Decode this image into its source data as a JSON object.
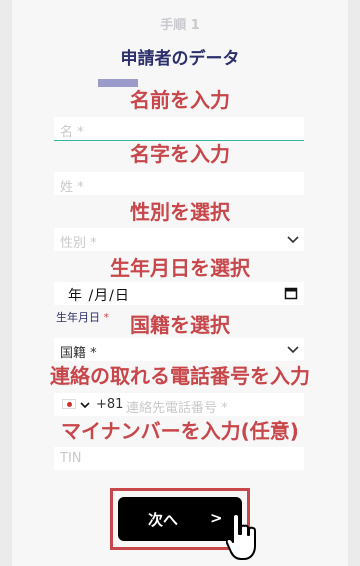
{
  "step_label": "手順 1",
  "section_title": "申請者のデータ",
  "annotations": {
    "first_name": "名前を入力",
    "last_name": "名字を入力",
    "gender": "性別を選択",
    "birthdate": "生年月日を選択",
    "nationality": "国籍を選択",
    "phone": "連絡の取れる電話番号を入力",
    "mynumber": "マイナンバーを入力(任意)"
  },
  "fields": {
    "first_name_placeholder": "名 *",
    "last_name_placeholder": "姓 *",
    "gender_placeholder": "性別 *",
    "birthdate_value": "年 /月/日",
    "birthdate_label": "生年月日",
    "required_mark": "*",
    "nationality_value": "国籍 *",
    "phone_code": "+81",
    "phone_placeholder": "連絡先電話番号 *",
    "tin_placeholder": "TIN"
  },
  "next_button": {
    "label": "次へ",
    "arrow": ">"
  }
}
